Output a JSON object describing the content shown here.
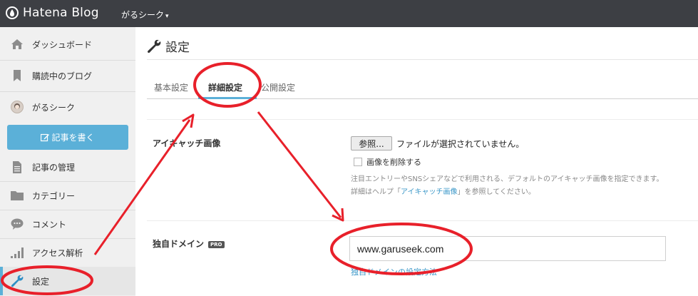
{
  "header": {
    "logo_text": "Hatena Blog",
    "blog_name": "がるシーク",
    "dropdown_caret": "▾"
  },
  "sidebar": {
    "items": [
      {
        "label": "ダッシュボード",
        "icon": "home-icon"
      },
      {
        "label": "購読中のブログ",
        "icon": "bookmark-icon"
      },
      {
        "label": "がるシーク",
        "icon": "avatar"
      },
      {
        "label": "記事の管理",
        "icon": "document-icon"
      },
      {
        "label": "カテゴリー",
        "icon": "folder-icon"
      },
      {
        "label": "コメント",
        "icon": "comment-icon"
      },
      {
        "label": "アクセス解析",
        "icon": "bar-chart-icon"
      },
      {
        "label": "設定",
        "icon": "wrench-icon"
      }
    ],
    "write_button": "記事を書く"
  },
  "main": {
    "title": "設定",
    "tabs": [
      {
        "label": "基本設定",
        "active": false
      },
      {
        "label": "詳細設定",
        "active": true
      },
      {
        "label": "公開設定",
        "active": false
      }
    ],
    "eyecatch": {
      "label": "アイキャッチ画像",
      "browse_button": "参照...",
      "file_status": "ファイルが選択されていません。",
      "delete_checkbox_label": "画像を削除する",
      "help_line1": "注目エントリーやSNSシェアなどで利用される、デフォルトのアイキャッチ画像を指定できます。",
      "help_line2_prefix": "詳細はヘルプ「",
      "help_link": "アイキャッチ画像",
      "help_line2_suffix": "」を参照してください。"
    },
    "custom_domain": {
      "label": "独自ドメイン",
      "badge": "PRO",
      "value": "www.garuseek.com",
      "help_link": "独自ドメインの設定方法"
    }
  },
  "colors": {
    "accent": "#5bb0d8",
    "header_bg": "#3d3f44",
    "sidebar_bg": "#f0f0f0",
    "annotation_red": "#e8202a"
  }
}
